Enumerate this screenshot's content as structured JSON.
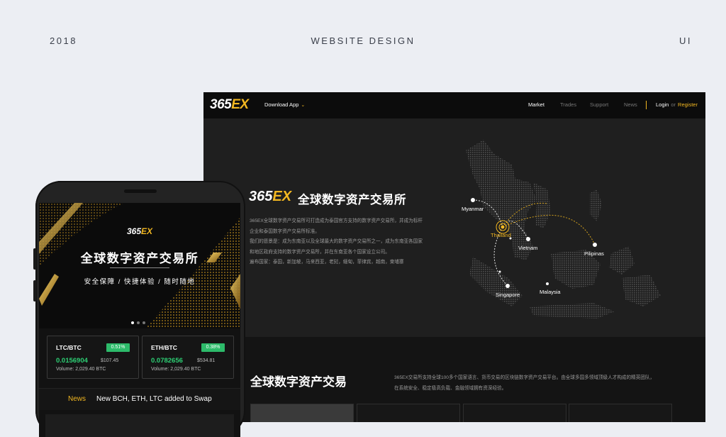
{
  "header": {
    "year": "2018",
    "title": "WEBSITE DESIGN",
    "right": "UI"
  },
  "desktop": {
    "logo": {
      "main": "365",
      "accent": "EX"
    },
    "nav": {
      "download": "Download App",
      "links": [
        "Market",
        "Trades",
        "Support",
        "News"
      ],
      "login": "Login",
      "or": "or",
      "register": "Register"
    },
    "hero": {
      "title": "全球数字资产交易所",
      "paragraphs": [
        "365EX全球数字资产交易所可打造成为泰国官方支持的数字资产交易所，并成为标杆企业和泰国数字资产交易所标准。",
        "我们的愿景是：成为东南亚以及全球最大的数字资产交易所之一，成为东南亚各国家和地区政府支持的数字资产交易所，并在东南亚各个国家设立公司。",
        "遍布国家：泰国，新加坡，马来西亚，老挝，缅甸，菲律宾，越南，柬埔寨"
      ]
    },
    "map_labels": [
      "Myanmar",
      "Thailand",
      "Vietnam",
      "Pilipinas",
      "Singapore",
      "Malaysia"
    ],
    "section2": {
      "title": "全球数字资产交易",
      "lines": [
        "365EX交易所支持全球100多个国家语言、货币交易的区块链数字资产交易平台。由全球多国多领域顶级人才构成的精英团队，",
        "在系统安全、稳定极高负载、金融领域拥有资深经验。"
      ]
    }
  },
  "mobile": {
    "logo": {
      "main": "365",
      "accent": "EX"
    },
    "title": "全球数字资产交易所",
    "subtitle": "安全保障 / 快捷体验 / 随时随地",
    "tickers": [
      {
        "pair": "LTC/BTC",
        "change": "0.51%",
        "price": "0.0156904",
        "usd": "$107.45",
        "volume": "Volume: 2,029.40 BTC"
      },
      {
        "pair": "ETH/BTC",
        "change": "0.38%",
        "price": "0.0782656",
        "usd": "$534.81",
        "volume": "Volume: 2,029.40 BTC"
      }
    ],
    "news": {
      "label": "News",
      "text": "New BCH, ETH, LTC added to Swap"
    }
  },
  "colors": {
    "accent": "#f2b721",
    "positive": "#2dbb6a",
    "background": "#eceef3"
  }
}
